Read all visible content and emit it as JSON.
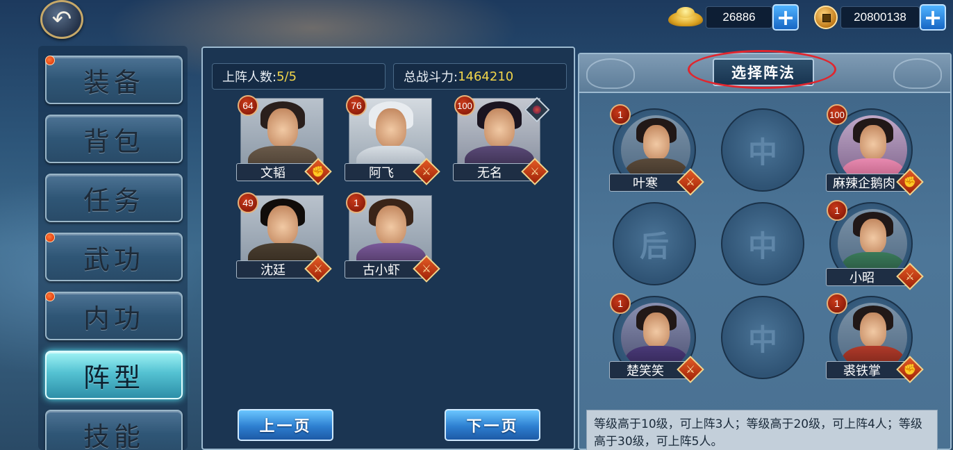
{
  "currency": {
    "gold": "26886",
    "coins": "20800138",
    "gold_icon": "gold-ingot-icon",
    "coin_icon": "copper-coin-icon",
    "plus_label": "+"
  },
  "back_icon": "↶",
  "menu": [
    {
      "label": "装备",
      "dot": true,
      "active": false
    },
    {
      "label": "背包",
      "dot": false,
      "active": false
    },
    {
      "label": "任务",
      "dot": false,
      "active": false
    },
    {
      "label": "武功",
      "dot": true,
      "active": false
    },
    {
      "label": "内功",
      "dot": true,
      "active": false
    },
    {
      "label": "阵型",
      "dot": false,
      "active": true
    },
    {
      "label": "技能",
      "dot": false,
      "active": false
    }
  ],
  "stats": {
    "count_label": "上阵人数:",
    "count_value": "5/5",
    "power_label": "总战斗力:",
    "power_value": "1464210"
  },
  "heroes": [
    {
      "name": "文韬",
      "level": "64",
      "type": "✊"
    },
    {
      "name": "阿飞",
      "level": "76",
      "type": "⚔"
    },
    {
      "name": "无名",
      "level": "100",
      "type": "⚔"
    },
    {
      "name": "沈廷",
      "level": "49",
      "type": "⚔"
    },
    {
      "name": "古小虾",
      "level": "1",
      "type": "⚔"
    }
  ],
  "pager": {
    "prev": "上一页",
    "next": "下一页"
  },
  "formation": {
    "select_label": "选择阵法",
    "slots": [
      {
        "name": "叶寒",
        "level": "1",
        "type": "⚔",
        "empty": false
      },
      {
        "label": "中",
        "empty": true
      },
      {
        "name": "麻辣企鹅肉",
        "level": "100",
        "type": "✊",
        "empty": false
      },
      {
        "label": "后",
        "empty": true
      },
      {
        "label": "中",
        "empty": true
      },
      {
        "name": "小昭",
        "level": "1",
        "type": "⚔",
        "empty": false
      },
      {
        "name": "楚笑笑",
        "level": "1",
        "type": "⚔",
        "empty": false
      },
      {
        "label": "中",
        "empty": true
      },
      {
        "name": "裘铁掌",
        "level": "1",
        "type": "✊",
        "empty": false
      }
    ],
    "info": "等级高于10级，可上阵3人；等级高于20级，可上阵4人；等级高于30级，可上阵5人。"
  }
}
